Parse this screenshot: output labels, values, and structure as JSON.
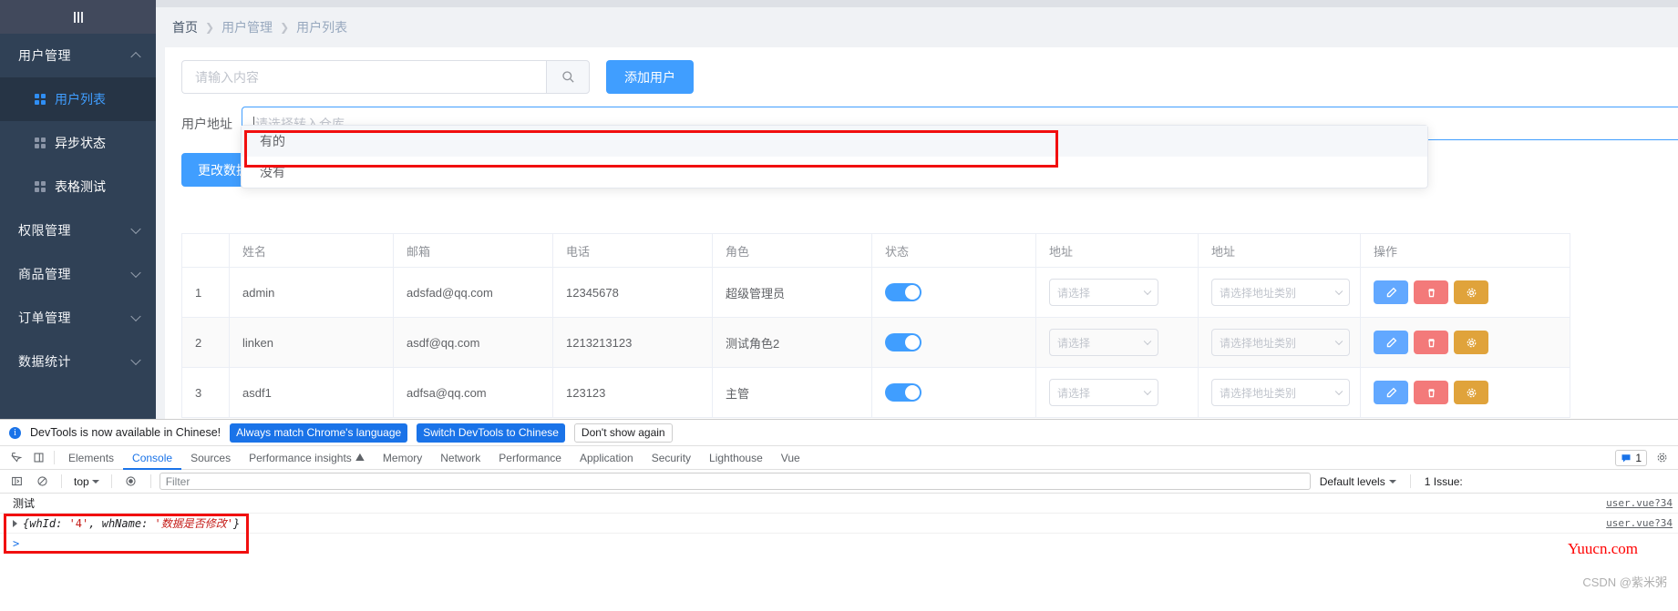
{
  "sidebar": {
    "toggle_icon": "hamburger-icon",
    "items": [
      {
        "label": "用户管理",
        "expanded": true,
        "icon": "chevron-up-icon"
      },
      {
        "label": "权限管理",
        "expanded": false,
        "icon": "chevron-down-icon"
      },
      {
        "label": "商品管理",
        "expanded": false,
        "icon": "chevron-down-icon"
      },
      {
        "label": "订单管理",
        "expanded": false,
        "icon": "chevron-down-icon"
      },
      {
        "label": "数据统计",
        "expanded": false,
        "icon": "chevron-down-icon"
      }
    ],
    "submenu": [
      {
        "label": "用户列表",
        "active": true,
        "icon": "grid-icon"
      },
      {
        "label": "异步状态",
        "active": false,
        "icon": "grid-icon"
      },
      {
        "label": "表格测试",
        "active": false,
        "icon": "grid-icon"
      }
    ]
  },
  "breadcrumb": [
    "首页",
    "用户管理",
    "用户列表"
  ],
  "toolbar": {
    "search_placeholder": "请输入内容",
    "search_value": "",
    "search_icon": "search-icon",
    "add_user_label": "添加用户",
    "change_data_label": "更改数据"
  },
  "form": {
    "address_label": "用户地址",
    "address_placeholder": "请选择转入仓库",
    "address_value": ""
  },
  "dropdown": {
    "options": [
      {
        "label": "有的",
        "hovered": true
      },
      {
        "label": "没有",
        "hovered": false
      }
    ]
  },
  "table": {
    "columns": [
      "",
      "姓名",
      "邮箱",
      "电话",
      "角色",
      "状态",
      "地址",
      "地址",
      "操作"
    ],
    "rows": [
      {
        "index": "1",
        "name": "admin",
        "email": "adsfad@qq.com",
        "phone": "12345678",
        "role": "超级管理员",
        "status_on": true,
        "addr1_placeholder": "请选择",
        "addr2_placeholder": "请选择地址类别"
      },
      {
        "index": "2",
        "name": "linken",
        "email": "asdf@qq.com",
        "phone": "1213213123",
        "role": "测试角色2",
        "status_on": true,
        "addr1_placeholder": "请选择",
        "addr2_placeholder": "请选择地址类别"
      },
      {
        "index": "3",
        "name": "asdf1",
        "email": "adfsa@qq.com",
        "phone": "123123",
        "role": "主管",
        "status_on": true,
        "addr1_placeholder": "请选择",
        "addr2_placeholder": "请选择地址类别"
      }
    ],
    "actions": [
      {
        "name": "edit",
        "icon": "pencil-icon",
        "color": "#62a8ff"
      },
      {
        "name": "delete",
        "icon": "trash-icon",
        "color": "#f37a7a"
      },
      {
        "name": "settings",
        "icon": "gear-icon",
        "color": "#e0a33b"
      }
    ]
  },
  "devtools": {
    "banner": {
      "icon": "info-icon",
      "message": "DevTools is now available in Chinese!",
      "always_match_label": "Always match Chrome's language",
      "switch_label": "Switch DevTools to Chinese",
      "dismiss_label": "Don't show again"
    },
    "tabs": [
      {
        "label": "Elements",
        "active": false
      },
      {
        "label": "Console",
        "active": true
      },
      {
        "label": "Sources",
        "active": false
      },
      {
        "label": "Performance insights",
        "active": false,
        "badge": "experiment-icon"
      },
      {
        "label": "Memory",
        "active": false
      },
      {
        "label": "Network",
        "active": false
      },
      {
        "label": "Performance",
        "active": false
      },
      {
        "label": "Application",
        "active": false
      },
      {
        "label": "Security",
        "active": false
      },
      {
        "label": "Lighthouse",
        "active": false
      },
      {
        "label": "Vue",
        "active": false
      }
    ],
    "message_count": "1",
    "toolbar": {
      "context": "top",
      "filter_placeholder": "Filter",
      "filter_value": "",
      "levels_label": "Default levels",
      "issues_label": "1 Issue:"
    },
    "console": {
      "lines": [
        {
          "type": "text",
          "text": "测试",
          "source": "user.vue?34"
        },
        {
          "type": "object",
          "prefix": "{whId: ",
          "id": "'4'",
          "mid": ", whName: ",
          "value": "'数据是否修改'",
          "suffix": "}",
          "source": "user.vue?34"
        }
      ],
      "prompt": ">"
    }
  },
  "watermarks": {
    "site": "Yuucn.com",
    "credit": "CSDN @紫米粥"
  }
}
